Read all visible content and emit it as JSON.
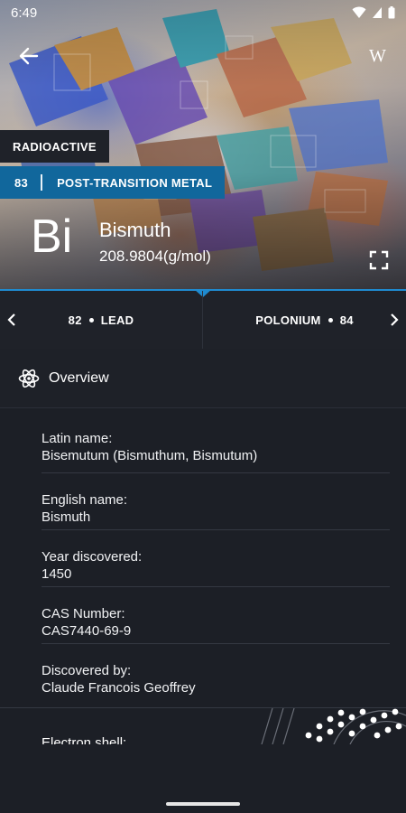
{
  "status_bar": {
    "time": "6:49"
  },
  "hero": {
    "tag_radioactive": "RADIOACTIVE",
    "atomic_number": "83",
    "category": "POST-TRANSITION METAL",
    "symbol": "Bi",
    "name": "Bismuth",
    "mass": "208.9804(g/mol)",
    "wiki_label": "W"
  },
  "nav": {
    "prev_number": "82",
    "prev_name": "LEAD",
    "next_name": "POLONIUM",
    "next_number": "84"
  },
  "overview": {
    "title": "Overview",
    "items": [
      {
        "label": "Latin name:",
        "value": "Bisemutum (Bismuthum, Bismutum)"
      },
      {
        "label": "English name:",
        "value": "Bismuth"
      },
      {
        "label": "Year discovered:",
        "value": "1450"
      },
      {
        "label": "CAS Number:",
        "value": "CAS7440-69-9"
      },
      {
        "label": "Discovered by:",
        "value": "Claude Francois Geoffrey"
      }
    ]
  },
  "electron_shell": {
    "label": "Electron shell:"
  },
  "colors": {
    "accent": "#1f8bd0",
    "category_bg": "#11679c",
    "panel": "#1f2229",
    "background": "#1c1f26"
  }
}
